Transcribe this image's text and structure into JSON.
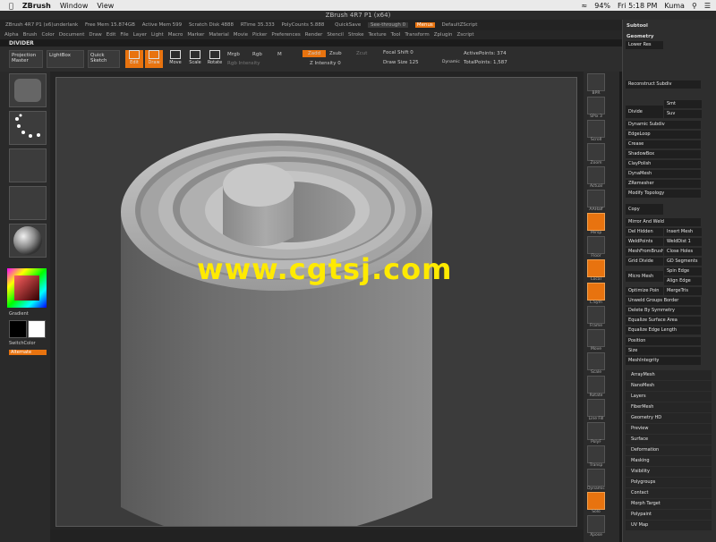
{
  "mac_menu": {
    "app": "ZBrush",
    "items": [
      "Window",
      "View"
    ],
    "battery": "94%",
    "clock": "Fri 5:18 PM",
    "user": "Kuma"
  },
  "window_title": "ZBrush 4R7 P1 (x64)",
  "info_bar": {
    "version": "ZBrush 4R7 P1 (x6)underlank",
    "free_mem": "Free Mem 15.874GB",
    "active_mem": "Active Mem 599",
    "scratch_disk": "Scratch Disk 4888",
    "rtime": "RTime 35.333",
    "poly_counts": "PolyCounts 5.888",
    "quicksave": "QuickSave",
    "see_through": "See-through 0",
    "menus": "Menus",
    "default_zscript": "DefaultZScript"
  },
  "menu_items": [
    "Alpha",
    "Brush",
    "Color",
    "Document",
    "Draw",
    "Edit",
    "File",
    "Layer",
    "Light",
    "Macro",
    "Marker",
    "Material",
    "Movie",
    "Picker",
    "Preferences",
    "Render",
    "Stencil",
    "Stroke",
    "Texture",
    "Tool",
    "Transform",
    "Zplugin",
    "Zscript"
  ],
  "divider_label": "DIVIDER",
  "toolbar": {
    "projection_master": "Projection Master",
    "lightbox": "LightBox",
    "quick_sketch": "Quick Sketch",
    "edit": "Edit",
    "draw": "Draw",
    "move": "Move",
    "scale": "Scale",
    "rotate": "Rotate",
    "mrgb": "Mrgb",
    "rgb": "Rgb",
    "m": "M",
    "rgb_intensity": "Rgb Intensity",
    "zadd": "Zadd",
    "zsub": "Zsub",
    "zcut": "Zcut",
    "z_intensity": "Z Intensity 0",
    "focal_shift": "Focal Shift 0",
    "draw_size": "Draw Size 125",
    "dynamic": "Dynamic",
    "active_points": "ActivePoints: 374",
    "total_points": "TotalPoints: 1,587"
  },
  "left_shelf": {
    "gradient": "Gradient",
    "switch_color": "SwitchColor",
    "alternate": "Alternate"
  },
  "right_shelf": [
    "BPR",
    "SPix 3",
    "Scroll",
    "Zoom",
    "Actual",
    "AAHalf",
    "Persp",
    "Floor",
    "Local",
    "L.Sym",
    "Frame",
    "Move",
    "Scale",
    "Rotate",
    "Line Fill",
    "PolyF",
    "Transp",
    "Dynamic",
    "Solo",
    "Xpose"
  ],
  "palette": {
    "subtool": "Subtool",
    "geometry": "Geometry",
    "lower_res": "Lower Res",
    "reconstruct_subdiv": "Reconstruct Subdiv",
    "divide": "Divide",
    "smt": "Smt",
    "suv": "Suv",
    "dynamic_subdiv": "Dynamic Subdiv",
    "edgeloop": "EdgeLoop",
    "crease": "Crease",
    "shadowbox": "ShadowBox",
    "claypolish": "ClayPolish",
    "dynamesh": "DynaMesh",
    "zremesher": "ZRemesher",
    "modify_topology": "Modify Topology",
    "copy": "Copy",
    "mirror_and_weld": "Mirror And Weld",
    "del_hidden": "Del Hidden",
    "insert_mesh": "Insert Mesh",
    "weldpoints": "WeldPoints",
    "welddist": "WeldDist 1",
    "meshfrombrush": "MeshFromBrush",
    "close_holes": "Close Holes",
    "grid_divide": "Grid Divide",
    "gd_segments": "GD Segments",
    "micro_mesh": "Micro Mesh",
    "spin_edge": "Spin Edge",
    "align_edge": "Align Edge",
    "optimize_points": "Optimize Poin",
    "mergetris": "MergeTris",
    "unweld_groups_border": "Unweld Groups Border",
    "delete_by_symmetry": "Delete By Symmetry",
    "equalize_surface_area": "Equalize Surface Area",
    "equalize_edge_length": "Equalize Edge Length",
    "position": "Position",
    "size": "Size",
    "meshintegrity": "MeshIntegrity",
    "sections": [
      "ArrayMesh",
      "NanoMesh",
      "Layers",
      "FiberMesh",
      "Geometry HD",
      "Preview",
      "Surface",
      "Deformation",
      "Masking",
      "Visibility",
      "Polygroups",
      "Contact",
      "Morph Target",
      "Polypaint",
      "UV Map"
    ]
  },
  "watermark": "www.cgtsj.com",
  "colors": {
    "accent": "#e8730f",
    "canvas": "#3b3b3b",
    "watermark": "#ffea00"
  }
}
